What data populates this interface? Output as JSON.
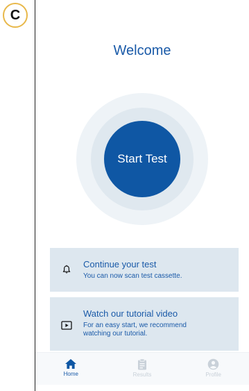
{
  "panel_label": "C",
  "screen": {
    "title": "Welcome",
    "start_button": "Start Test"
  },
  "cards": [
    {
      "title": "Continue your test",
      "subtitle": "You can now scan test cassette.",
      "icon": "bell-icon"
    },
    {
      "title": "Watch our tutorial video",
      "subtitle_lines": [
        "For an easy start, we recommend",
        "watching our tutorial."
      ],
      "icon": "video-play-icon"
    }
  ],
  "tabbar": {
    "items": [
      {
        "label": "Home",
        "icon": "home-icon",
        "active": true
      },
      {
        "label": "Results",
        "icon": "clipboard-icon",
        "active": false
      },
      {
        "label": "Profile",
        "icon": "user-icon",
        "active": false
      }
    ]
  },
  "colors": {
    "primary": "#0f57a4",
    "text_blue": "#1a5aa8",
    "card_bg": "#dde7ef",
    "ring_outer": "#eef3f7",
    "ring_inner": "#dfe8ef",
    "inactive": "#c9d1d9",
    "label_border": "#e8b84a"
  }
}
